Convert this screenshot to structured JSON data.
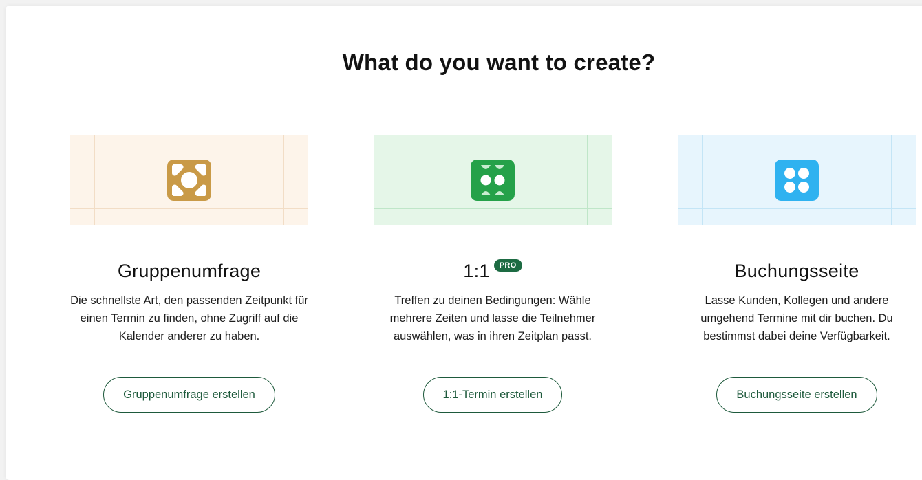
{
  "page": {
    "title": "What do you want to create?"
  },
  "cards": [
    {
      "title": "Gruppenumfrage",
      "description": "Die schnellste Art, den passenden Zeitpunkt für einen Termin zu finden, ohne Zugriff auf die Kalender anderer zu haben.",
      "button": "Gruppenumfrage erstellen",
      "icon": "group-poll-icon",
      "banner_color": "#fdf4ea",
      "grid_color": "#f2ddc6",
      "icon_color": "#c99a47"
    },
    {
      "title": "1:1",
      "badge": "PRO",
      "description": "Treffen zu deinen Bedingungen: Wähle mehrere Zeiten und lasse die Teilnehmer auswählen, was in ihren Zeitplan passt.",
      "button": "1:1-Termin erstellen",
      "icon": "one-on-one-icon",
      "banner_color": "#e5f6e8",
      "grid_color": "#bfe6c8",
      "icon_color": "#25a149"
    },
    {
      "title": "Buchungsseite",
      "description": "Lasse Kunden, Kollegen und andere umgehend Termine mit dir buchen. Du bestimmst dabei deine Verfügbarkeit.",
      "button": "Buchungsseite erstellen",
      "icon": "booking-page-icon",
      "banner_color": "#e7f5fd",
      "grid_color": "#c4e5f6",
      "icon_color": "#2fb2f0"
    }
  ]
}
